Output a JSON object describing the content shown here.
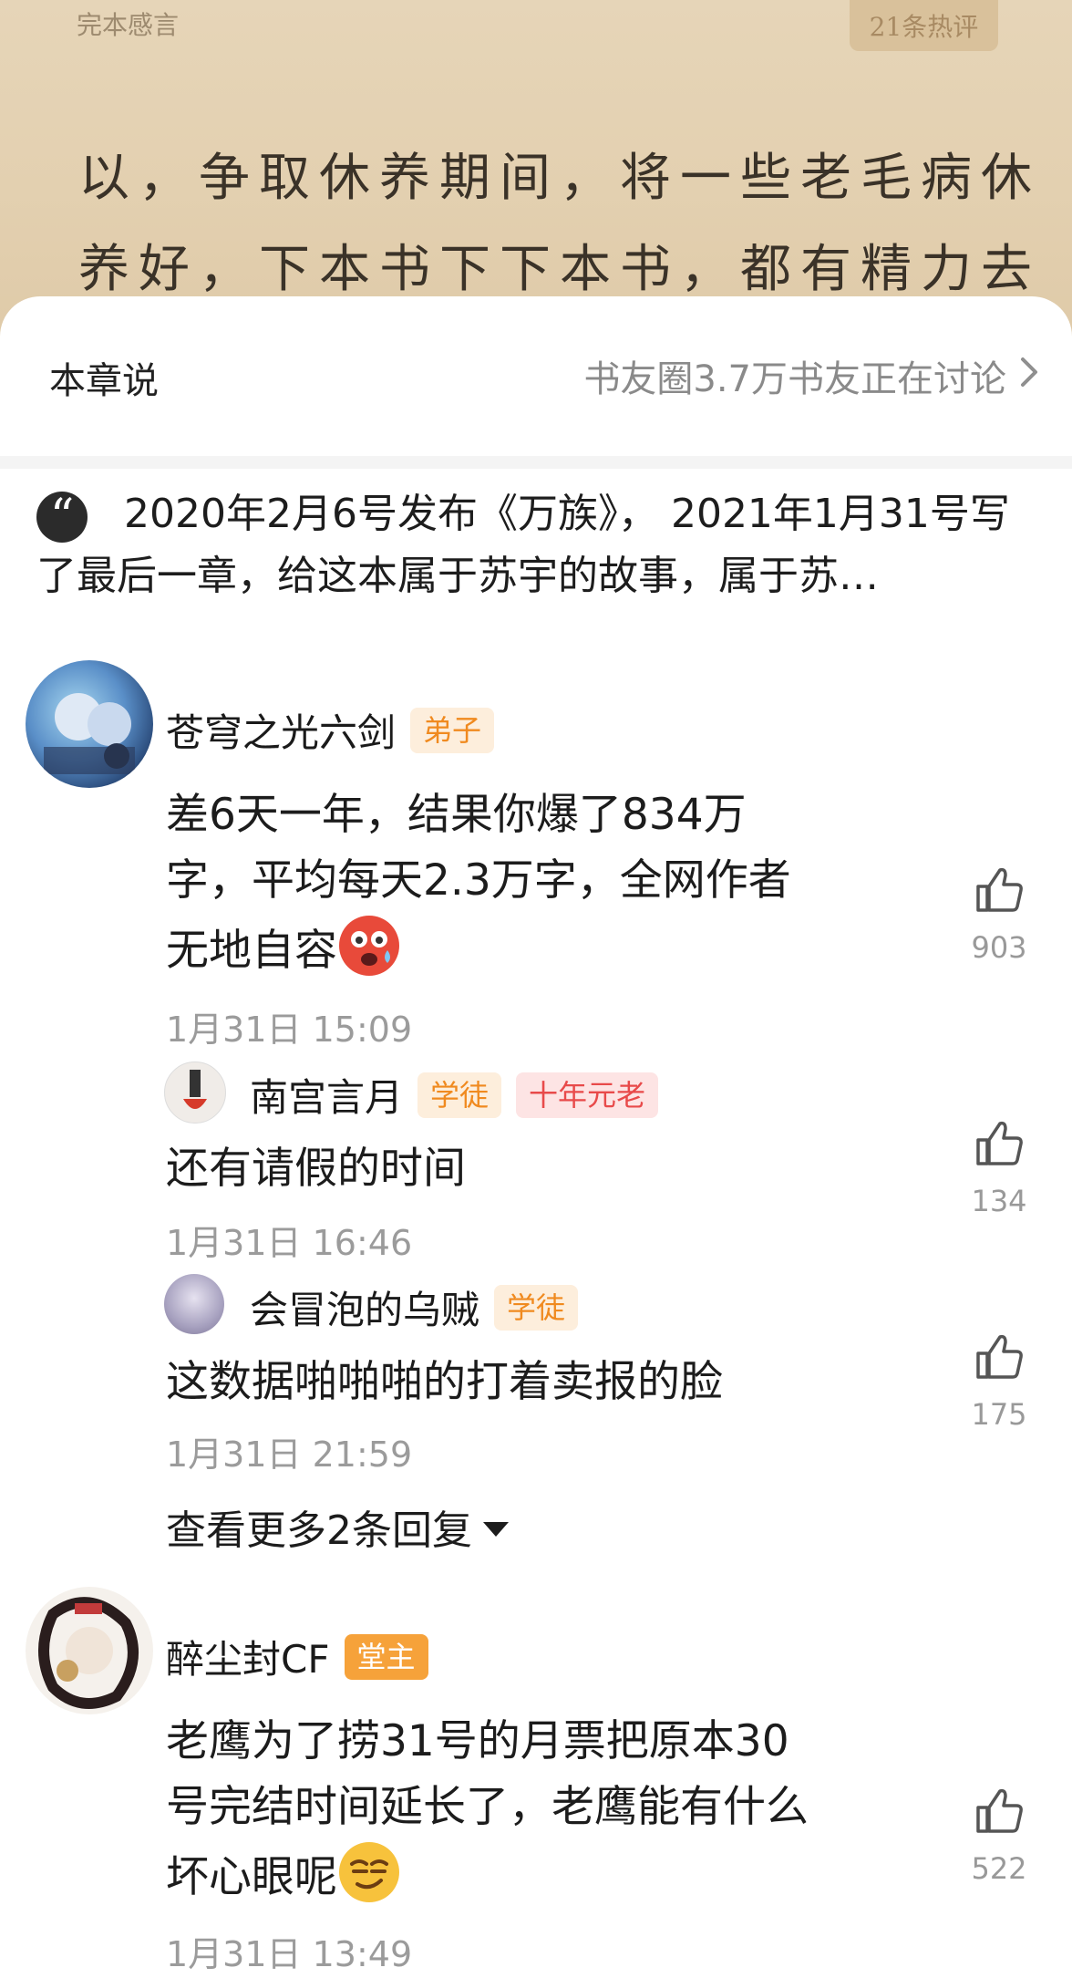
{
  "reader": {
    "chapter_label": "完本感言",
    "hot_count": "21条热评",
    "lines": [
      "以，争取休养期间，将一些老毛病休",
      "养好，下本书下下本书，都有精力去"
    ]
  },
  "sheet": {
    "title": "本章说",
    "discussion_link": "书友圈3.7万书友正在讨论"
  },
  "quote": {
    "text": "2020年2月6号发布《万族》， 2021年1月31号写了最后一章，给这本属于苏宇的故事，属于苏…"
  },
  "comments": [
    {
      "user": "苍穹之光六剑",
      "badges": [
        "弟子"
      ],
      "text": "差6天一年，结果你爆了834万字，平均每天2.3万字，全网作者无地自容",
      "emoji": "scared-face-emoji",
      "date": "1月31日 15:09",
      "likes": "903",
      "replies": [
        {
          "user": "南宫言月",
          "badges": [
            "学徒",
            "十年元老"
          ],
          "text": "还有请假的时间",
          "date": "1月31日 16:46",
          "likes": "134"
        },
        {
          "user": "会冒泡的乌贼",
          "badges": [
            "学徒"
          ],
          "text": "这数据啪啪啪的打着卖报的脸",
          "date": "1月31日 21:59",
          "likes": "175"
        }
      ],
      "more_replies": "查看更多2条回复"
    },
    {
      "user": "醉尘封CF",
      "badges": [
        "堂主"
      ],
      "text_lines": [
        "老鹰为了捞31号的月票把原本30",
        "号完结时间延长了，老鹰能有什么",
        "坏心眼呢"
      ],
      "emoji": "smirk-face-emoji",
      "date": "1月31日 13:49",
      "likes": "522"
    }
  ],
  "comment1_lines": [
    "差6天一年，结果你爆了834万",
    "字，平均每天2.3万字，全网作者",
    "无地自容"
  ],
  "colors": {
    "paper": "#e3d0b0",
    "badge_orange": "#f08a1f",
    "badge_red": "#e84a4a",
    "muted": "#9b9b9b"
  }
}
